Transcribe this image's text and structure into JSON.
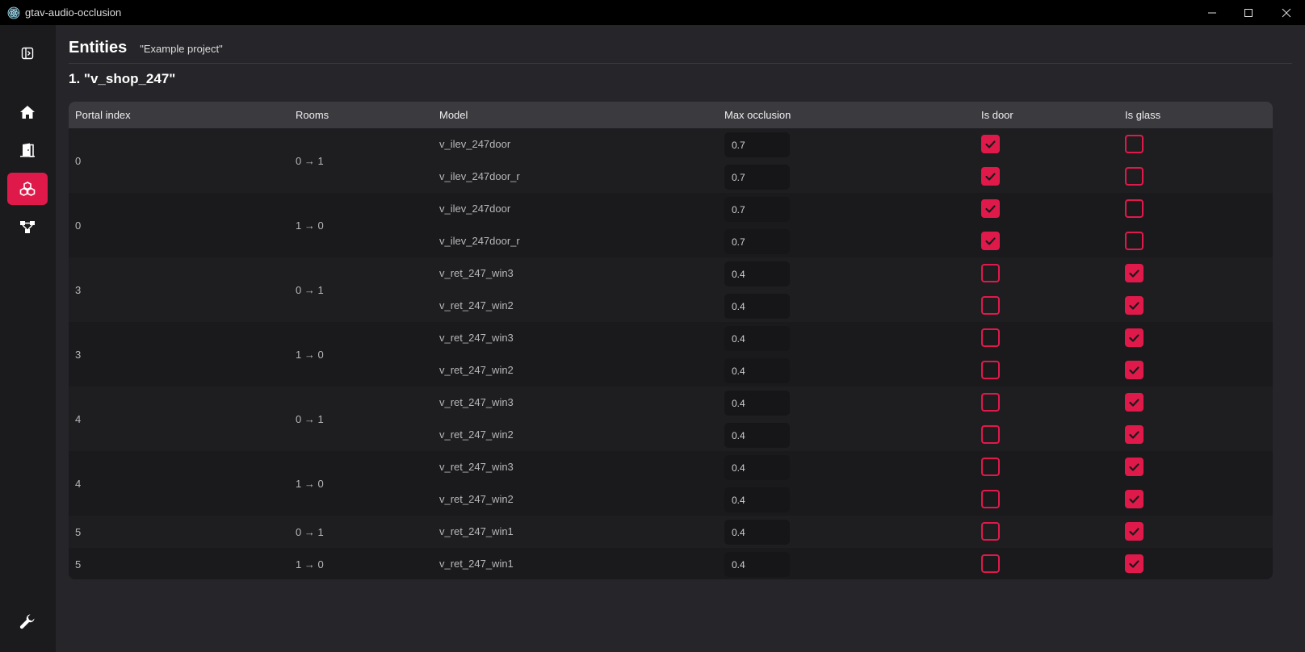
{
  "window": {
    "title": "gtav-audio-occlusion"
  },
  "sidebar": {
    "items": [
      {
        "icon": "sidebar-toggle-icon"
      },
      {
        "icon": "home-icon"
      },
      {
        "icon": "door-icon"
      },
      {
        "icon": "entities-icon",
        "active": true
      },
      {
        "icon": "graph-icon"
      },
      {
        "icon": "wrench-icon"
      }
    ]
  },
  "header": {
    "title": "Entities",
    "subtitle": "\"Example project\""
  },
  "section": {
    "title": "1.  \"v_shop_247\""
  },
  "table": {
    "columns": [
      "Portal index",
      "Rooms",
      "Model",
      "Max occlusion",
      "Is door",
      "Is glass"
    ],
    "groups": [
      {
        "portal": "0",
        "rooms": "0 → 1",
        "rows": [
          {
            "model": "v_ilev_247door",
            "occlusion": "0.7",
            "is_door": true,
            "is_glass": false
          },
          {
            "model": "v_ilev_247door_r",
            "occlusion": "0.7",
            "is_door": true,
            "is_glass": false
          }
        ]
      },
      {
        "portal": "0",
        "rooms": "1 → 0",
        "rows": [
          {
            "model": "v_ilev_247door",
            "occlusion": "0.7",
            "is_door": true,
            "is_glass": false
          },
          {
            "model": "v_ilev_247door_r",
            "occlusion": "0.7",
            "is_door": true,
            "is_glass": false
          }
        ]
      },
      {
        "portal": "3",
        "rooms": "0 → 1",
        "rows": [
          {
            "model": "v_ret_247_win3",
            "occlusion": "0.4",
            "is_door": false,
            "is_glass": true
          },
          {
            "model": "v_ret_247_win2",
            "occlusion": "0.4",
            "is_door": false,
            "is_glass": true
          }
        ]
      },
      {
        "portal": "3",
        "rooms": "1 → 0",
        "rows": [
          {
            "model": "v_ret_247_win3",
            "occlusion": "0.4",
            "is_door": false,
            "is_glass": true
          },
          {
            "model": "v_ret_247_win2",
            "occlusion": "0.4",
            "is_door": false,
            "is_glass": true
          }
        ]
      },
      {
        "portal": "4",
        "rooms": "0 → 1",
        "rows": [
          {
            "model": "v_ret_247_win3",
            "occlusion": "0.4",
            "is_door": false,
            "is_glass": true
          },
          {
            "model": "v_ret_247_win2",
            "occlusion": "0.4",
            "is_door": false,
            "is_glass": true
          }
        ]
      },
      {
        "portal": "4",
        "rooms": "1 → 0",
        "rows": [
          {
            "model": "v_ret_247_win3",
            "occlusion": "0.4",
            "is_door": false,
            "is_glass": true
          },
          {
            "model": "v_ret_247_win2",
            "occlusion": "0.4",
            "is_door": false,
            "is_glass": true
          }
        ]
      },
      {
        "portal": "5",
        "rooms": "0 → 1",
        "rows": [
          {
            "model": "v_ret_247_win1",
            "occlusion": "0.4",
            "is_door": false,
            "is_glass": true
          }
        ]
      },
      {
        "portal": "5",
        "rooms": "1 → 0",
        "rows": [
          {
            "model": "v_ret_247_win1",
            "occlusion": "0.4",
            "is_door": false,
            "is_glass": true
          }
        ]
      }
    ]
  },
  "colors": {
    "accent": "#e0194b",
    "background": "#26262a",
    "sidebar": "#1b1b1e"
  }
}
